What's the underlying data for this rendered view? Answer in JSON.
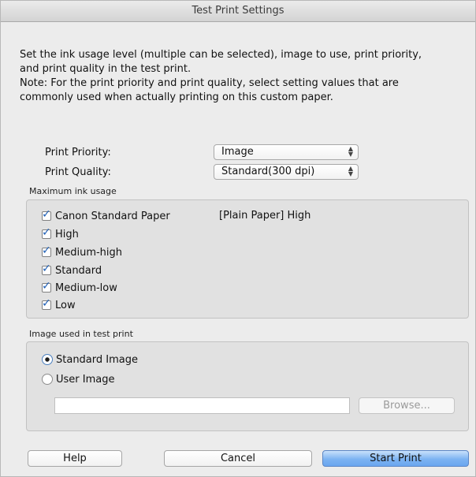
{
  "window": {
    "title": "Test Print Settings"
  },
  "intro": {
    "line1": "Set the ink usage level (multiple can be selected), image to use, print priority,",
    "line2": "and print quality in the test print.",
    "line3": "Note: For the print priority and print quality, select setting values that are",
    "line4": "commonly used when actually printing on this custom paper."
  },
  "settings": {
    "print_priority": {
      "label": "Print Priority:",
      "value": "Image"
    },
    "print_quality": {
      "label": "Print Quality:",
      "value": "Standard(300 dpi)"
    }
  },
  "ink_usage": {
    "title": "Maximum ink usage",
    "options": [
      {
        "label": "Canon Standard Paper",
        "checked": true
      },
      {
        "label": "High",
        "checked": true
      },
      {
        "label": "Medium-high",
        "checked": true
      },
      {
        "label": "Standard",
        "checked": true
      },
      {
        "label": "Medium-low",
        "checked": true
      },
      {
        "label": "Low",
        "checked": true
      }
    ],
    "canon_standard_value": "[Plain Paper] High"
  },
  "image_group": {
    "title": "Image used in test print",
    "options": [
      {
        "label": "Standard Image",
        "selected": true
      },
      {
        "label": "User Image",
        "selected": false
      }
    ],
    "file_path": "",
    "browse_label": "Browse..."
  },
  "buttons": {
    "help": "Help",
    "cancel": "Cancel",
    "start_print": "Start Print"
  },
  "colors": {
    "accent": "#6aa6ef",
    "check": "#1f5fb5"
  }
}
